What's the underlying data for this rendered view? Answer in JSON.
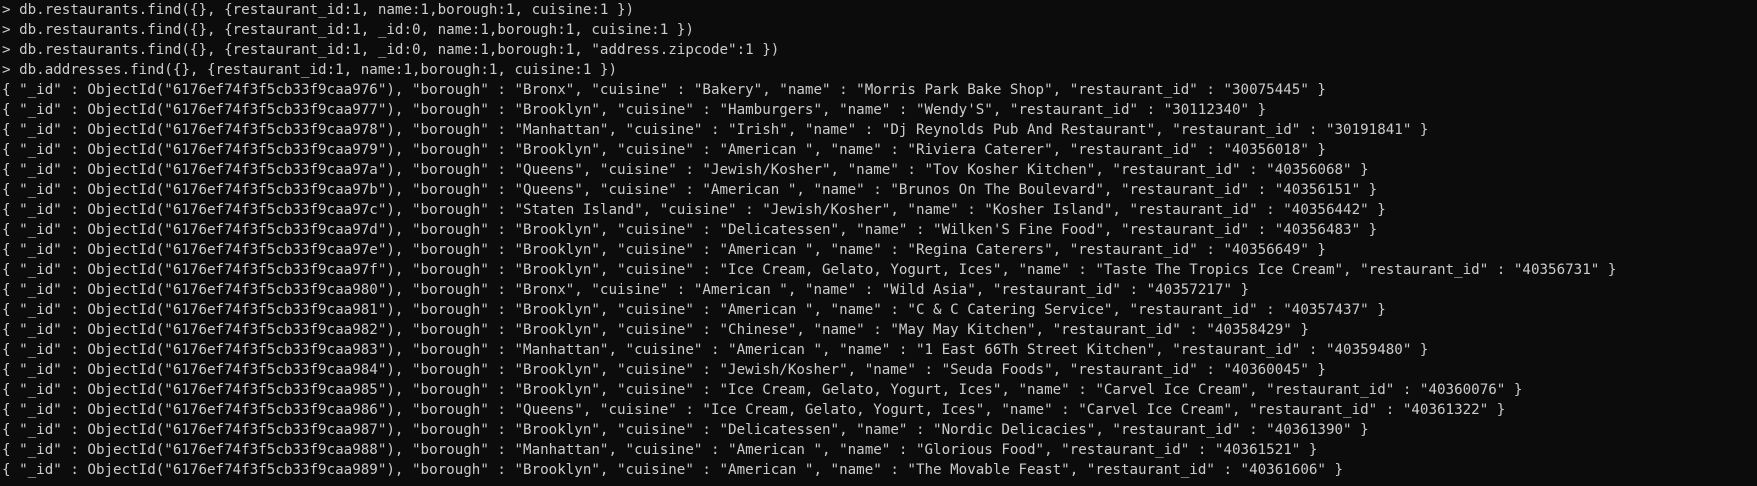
{
  "terminal": {
    "commands": [
      "> db.restaurants.find({}, {restaurant_id:1, name:1,borough:1, cuisine:1 })",
      "> db.restaurants.find({}, {restaurant_id:1, _id:0, name:1,borough:1, cuisine:1 })",
      "> db.restaurants.find({}, {restaurant_id:1, _id:0, name:1,borough:1, \"address.zipcode\":1 })",
      "> db.addresses.find({}, {restaurant_id:1, name:1,borough:1, cuisine:1 })"
    ],
    "results": [
      "{ \"_id\" : ObjectId(\"6176ef74f3f5cb33f9caa976\"), \"borough\" : \"Bronx\", \"cuisine\" : \"Bakery\", \"name\" : \"Morris Park Bake Shop\", \"restaurant_id\" : \"30075445\" }",
      "{ \"_id\" : ObjectId(\"6176ef74f3f5cb33f9caa977\"), \"borough\" : \"Brooklyn\", \"cuisine\" : \"Hamburgers\", \"name\" : \"Wendy'S\", \"restaurant_id\" : \"30112340\" }",
      "{ \"_id\" : ObjectId(\"6176ef74f3f5cb33f9caa978\"), \"borough\" : \"Manhattan\", \"cuisine\" : \"Irish\", \"name\" : \"Dj Reynolds Pub And Restaurant\", \"restaurant_id\" : \"30191841\" }",
      "{ \"_id\" : ObjectId(\"6176ef74f3f5cb33f9caa979\"), \"borough\" : \"Brooklyn\", \"cuisine\" : \"American \", \"name\" : \"Riviera Caterer\", \"restaurant_id\" : \"40356018\" }",
      "{ \"_id\" : ObjectId(\"6176ef74f3f5cb33f9caa97a\"), \"borough\" : \"Queens\", \"cuisine\" : \"Jewish/Kosher\", \"name\" : \"Tov Kosher Kitchen\", \"restaurant_id\" : \"40356068\" }",
      "{ \"_id\" : ObjectId(\"6176ef74f3f5cb33f9caa97b\"), \"borough\" : \"Queens\", \"cuisine\" : \"American \", \"name\" : \"Brunos On The Boulevard\", \"restaurant_id\" : \"40356151\" }",
      "{ \"_id\" : ObjectId(\"6176ef74f3f5cb33f9caa97c\"), \"borough\" : \"Staten Island\", \"cuisine\" : \"Jewish/Kosher\", \"name\" : \"Kosher Island\", \"restaurant_id\" : \"40356442\" }",
      "{ \"_id\" : ObjectId(\"6176ef74f3f5cb33f9caa97d\"), \"borough\" : \"Brooklyn\", \"cuisine\" : \"Delicatessen\", \"name\" : \"Wilken'S Fine Food\", \"restaurant_id\" : \"40356483\" }",
      "{ \"_id\" : ObjectId(\"6176ef74f3f5cb33f9caa97e\"), \"borough\" : \"Brooklyn\", \"cuisine\" : \"American \", \"name\" : \"Regina Caterers\", \"restaurant_id\" : \"40356649\" }",
      "{ \"_id\" : ObjectId(\"6176ef74f3f5cb33f9caa97f\"), \"borough\" : \"Brooklyn\", \"cuisine\" : \"Ice Cream, Gelato, Yogurt, Ices\", \"name\" : \"Taste The Tropics Ice Cream\", \"restaurant_id\" : \"40356731\" }",
      "{ \"_id\" : ObjectId(\"6176ef74f3f5cb33f9caa980\"), \"borough\" : \"Bronx\", \"cuisine\" : \"American \", \"name\" : \"Wild Asia\", \"restaurant_id\" : \"40357217\" }",
      "{ \"_id\" : ObjectId(\"6176ef74f3f5cb33f9caa981\"), \"borough\" : \"Brooklyn\", \"cuisine\" : \"American \", \"name\" : \"C & C Catering Service\", \"restaurant_id\" : \"40357437\" }",
      "{ \"_id\" : ObjectId(\"6176ef74f3f5cb33f9caa982\"), \"borough\" : \"Brooklyn\", \"cuisine\" : \"Chinese\", \"name\" : \"May May Kitchen\", \"restaurant_id\" : \"40358429\" }",
      "{ \"_id\" : ObjectId(\"6176ef74f3f5cb33f9caa983\"), \"borough\" : \"Manhattan\", \"cuisine\" : \"American \", \"name\" : \"1 East 66Th Street Kitchen\", \"restaurant_id\" : \"40359480\" }",
      "{ \"_id\" : ObjectId(\"6176ef74f3f5cb33f9caa984\"), \"borough\" : \"Brooklyn\", \"cuisine\" : \"Jewish/Kosher\", \"name\" : \"Seuda Foods\", \"restaurant_id\" : \"40360045\" }",
      "{ \"_id\" : ObjectId(\"6176ef74f3f5cb33f9caa985\"), \"borough\" : \"Brooklyn\", \"cuisine\" : \"Ice Cream, Gelato, Yogurt, Ices\", \"name\" : \"Carvel Ice Cream\", \"restaurant_id\" : \"40360076\" }",
      "{ \"_id\" : ObjectId(\"6176ef74f3f5cb33f9caa986\"), \"borough\" : \"Queens\", \"cuisine\" : \"Ice Cream, Gelato, Yogurt, Ices\", \"name\" : \"Carvel Ice Cream\", \"restaurant_id\" : \"40361322\" }",
      "{ \"_id\" : ObjectId(\"6176ef74f3f5cb33f9caa987\"), \"borough\" : \"Brooklyn\", \"cuisine\" : \"Delicatessen\", \"name\" : \"Nordic Delicacies\", \"restaurant_id\" : \"40361390\" }",
      "{ \"_id\" : ObjectId(\"6176ef74f3f5cb33f9caa988\"), \"borough\" : \"Manhattan\", \"cuisine\" : \"American \", \"name\" : \"Glorious Food\", \"restaurant_id\" : \"40361521\" }",
      "{ \"_id\" : ObjectId(\"6176ef74f3f5cb33f9caa989\"), \"borough\" : \"Brooklyn\", \"cuisine\" : \"American \", \"name\" : \"The Movable Feast\", \"restaurant_id\" : \"40361606\" }"
    ]
  },
  "colors": {
    "background": "#0c0c0c",
    "text": "#cccccc"
  }
}
